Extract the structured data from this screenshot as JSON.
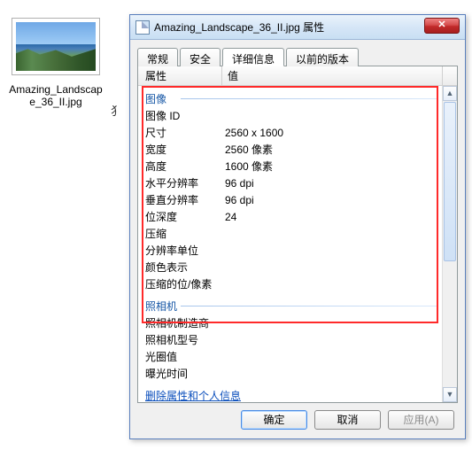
{
  "file": {
    "name": "Amazing_Landscape_36_II.jpg"
  },
  "stray": "犭",
  "dialog": {
    "title": "Amazing_Landscape_36_II.jpg 属性",
    "close_glyph": "✕",
    "tabs": {
      "general": "常规",
      "security": "安全",
      "details": "详细信息",
      "prev": "以前的版本"
    },
    "headers": {
      "property": "属性",
      "value": "值"
    },
    "sections": {
      "image": {
        "title": "图像",
        "rows": {
          "image_id": {
            "k": "图像 ID",
            "v": ""
          },
          "dimensions": {
            "k": "尺寸",
            "v": "2560 x 1600"
          },
          "width": {
            "k": "宽度",
            "v": "2560 像素"
          },
          "height": {
            "k": "高度",
            "v": "1600 像素"
          },
          "hres": {
            "k": "水平分辨率",
            "v": "96 dpi"
          },
          "vres": {
            "k": "垂直分辨率",
            "v": "96 dpi"
          },
          "bitdepth": {
            "k": "位深度",
            "v": "24"
          },
          "compression": {
            "k": "压缩",
            "v": ""
          },
          "resunit": {
            "k": "分辨率单位",
            "v": ""
          },
          "colorrep": {
            "k": "颜色表示",
            "v": ""
          },
          "compbpp": {
            "k": "压缩的位/像素",
            "v": ""
          }
        }
      },
      "camera": {
        "title": "照相机",
        "rows": {
          "maker": {
            "k": "照相机制造商",
            "v": ""
          },
          "model": {
            "k": "照相机型号",
            "v": ""
          },
          "fstop": {
            "k": "光圈值",
            "v": ""
          },
          "exposure": {
            "k": "曝光时间",
            "v": ""
          }
        }
      }
    },
    "link": "删除属性和个人信息",
    "buttons": {
      "ok": "确定",
      "cancel": "取消",
      "apply": "应用(A)"
    }
  }
}
